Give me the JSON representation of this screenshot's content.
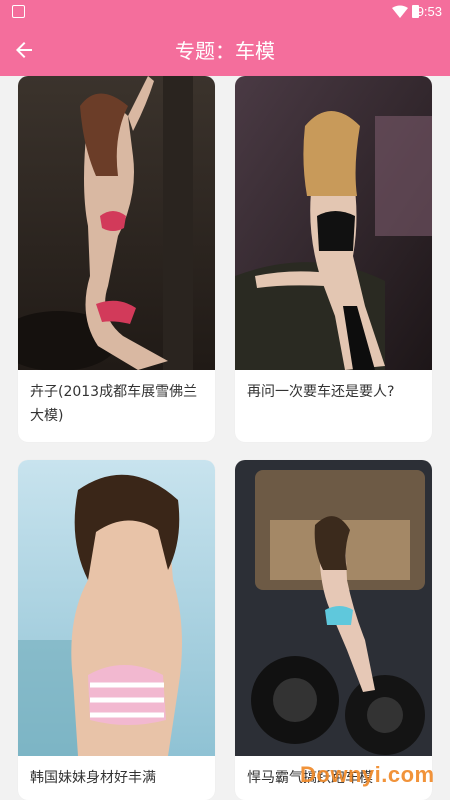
{
  "status_bar": {
    "time": "9:53"
  },
  "app_bar": {
    "title": "专题：车模",
    "back_icon": "arrow-left-icon"
  },
  "items": [
    {
      "caption": "卉子(2013成都车展雪佛兰大模)",
      "icon": "photo-woman-red-bikini"
    },
    {
      "caption": "再问一次要车还是要人?",
      "icon": "photo-woman-black-lingerie-car"
    },
    {
      "caption": "韩国妹妹身材好丰满",
      "icon": "photo-woman-pink-striped-bikini"
    },
    {
      "caption": "悍马霸气搞跃跑车模",
      "icon": "photo-woman-suv-tires"
    }
  ],
  "overlay": {
    "watermark": "Downyi.com"
  },
  "colors": {
    "primary": "#f46e9c",
    "background": "#f2f2f2",
    "card": "#ffffff",
    "watermark": "#f08a2a"
  }
}
